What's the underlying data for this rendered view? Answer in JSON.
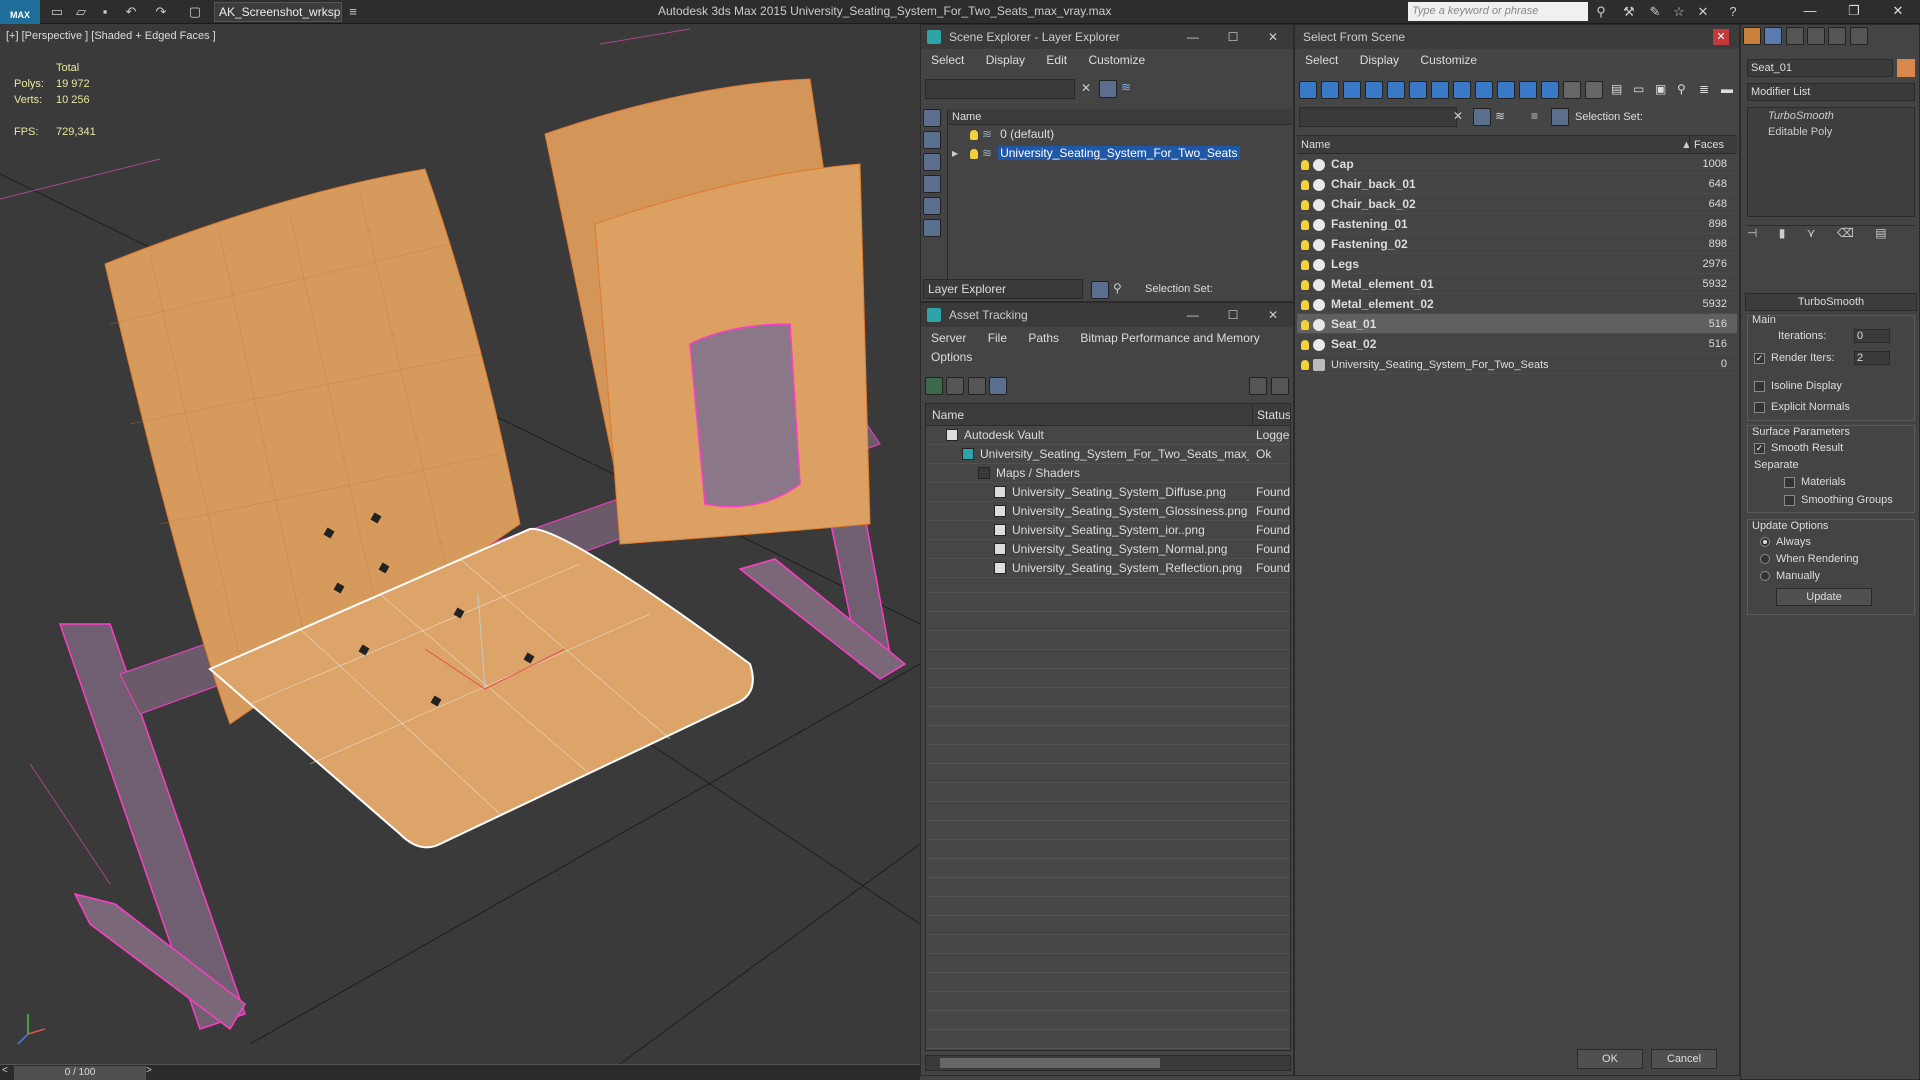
{
  "titlebar": {
    "logo": "MAX",
    "workspace": "AK_Screenshot_wrksp",
    "title": "Autodesk 3ds Max  2015     University_Seating_System_For_Two_Seats_max_vray.max",
    "search_placeholder": "Type a keyword or phrase"
  },
  "viewport": {
    "label": "[+] [Perspective ] [Shaded + Edged Faces ]",
    "stats": {
      "total_label": "Total",
      "polys_label": "Polys:",
      "polys": "19 972",
      "verts_label": "Verts:",
      "verts": "10 256",
      "fps_label": "FPS:",
      "fps": "729,341"
    },
    "time": "0 / 100"
  },
  "scene_explorer": {
    "title": "Scene Explorer - Layer Explorer",
    "menu": [
      "Select",
      "Display",
      "Edit",
      "Customize"
    ],
    "col_name": "Name",
    "layers": [
      {
        "name": "0 (default)",
        "selected": false
      },
      {
        "name": "University_Seating_System_For_Two_Seats",
        "selected": true
      }
    ],
    "footer_explorer": "Layer Explorer",
    "selection_set": "Selection Set:"
  },
  "asset_tracking": {
    "title": "Asset Tracking",
    "menu": [
      "Server",
      "File",
      "Paths",
      "Bitmap Performance and Memory"
    ],
    "menu2": "Options",
    "col_name": "Name",
    "col_status": "Status",
    "rows": [
      {
        "name": "Autodesk Vault",
        "status": "Logged",
        "indent": 0
      },
      {
        "name": "University_Seating_System_For_Two_Seats_max_...",
        "status": "Ok",
        "indent": 1
      },
      {
        "name": "Maps / Shaders",
        "status": "",
        "indent": 2
      },
      {
        "name": "University_Seating_System_Diffuse.png",
        "status": "Found",
        "indent": 3
      },
      {
        "name": "University_Seating_System_Glossiness.png",
        "status": "Found",
        "indent": 3
      },
      {
        "name": "University_Seating_System_ior..png",
        "status": "Found",
        "indent": 3
      },
      {
        "name": "University_Seating_System_Normal.png",
        "status": "Found",
        "indent": 3
      },
      {
        "name": "University_Seating_System_Reflection.png",
        "status": "Found",
        "indent": 3
      }
    ]
  },
  "select_from_scene": {
    "title": "Select From Scene",
    "menu": [
      "Select",
      "Display",
      "Customize"
    ],
    "selection_set": "Selection Set:",
    "col_name": "Name",
    "col_faces": "Faces",
    "objects": [
      {
        "name": "Cap",
        "faces": "1008",
        "selected": false
      },
      {
        "name": "Chair_back_01",
        "faces": "648",
        "selected": false
      },
      {
        "name": "Chair_back_02",
        "faces": "648",
        "selected": false
      },
      {
        "name": "Fastening_01",
        "faces": "898",
        "selected": false
      },
      {
        "name": "Fastening_02",
        "faces": "898",
        "selected": false
      },
      {
        "name": "Legs",
        "faces": "2976",
        "selected": false
      },
      {
        "name": "Metal_element_01",
        "faces": "5932",
        "selected": false
      },
      {
        "name": "Metal_element_02",
        "faces": "5932",
        "selected": false
      },
      {
        "name": "Seat_01",
        "faces": "516",
        "selected": true
      },
      {
        "name": "Seat_02",
        "faces": "516",
        "selected": false
      },
      {
        "name": "University_Seating_System_For_Two_Seats",
        "faces": "0",
        "selected": false
      }
    ],
    "ok": "OK",
    "cancel": "Cancel"
  },
  "command_panel": {
    "object_name": "Seat_01",
    "modifier_list": "Modifier List",
    "stack": [
      "TurboSmooth",
      "Editable Poly"
    ],
    "rollout_title": "TurboSmooth",
    "main": "Main",
    "iterations_label": "Iterations:",
    "iterations": "0",
    "render_iters_label": "Render Iters:",
    "render_iters": "2",
    "isoline": "Isoline Display",
    "explicit_normals": "Explicit Normals",
    "surface_params": "Surface Parameters",
    "smooth_result": "Smooth Result",
    "separate": "Separate",
    "materials": "Materials",
    "smoothing_groups": "Smoothing Groups",
    "update_options": "Update Options",
    "always": "Always",
    "when_rendering": "When Rendering",
    "manually": "Manually",
    "update": "Update"
  },
  "colors": {
    "selection": "#2058a8",
    "wood": "#d89a5c",
    "wire_pink": "#ff3cc8",
    "metal": "#7a6878"
  }
}
